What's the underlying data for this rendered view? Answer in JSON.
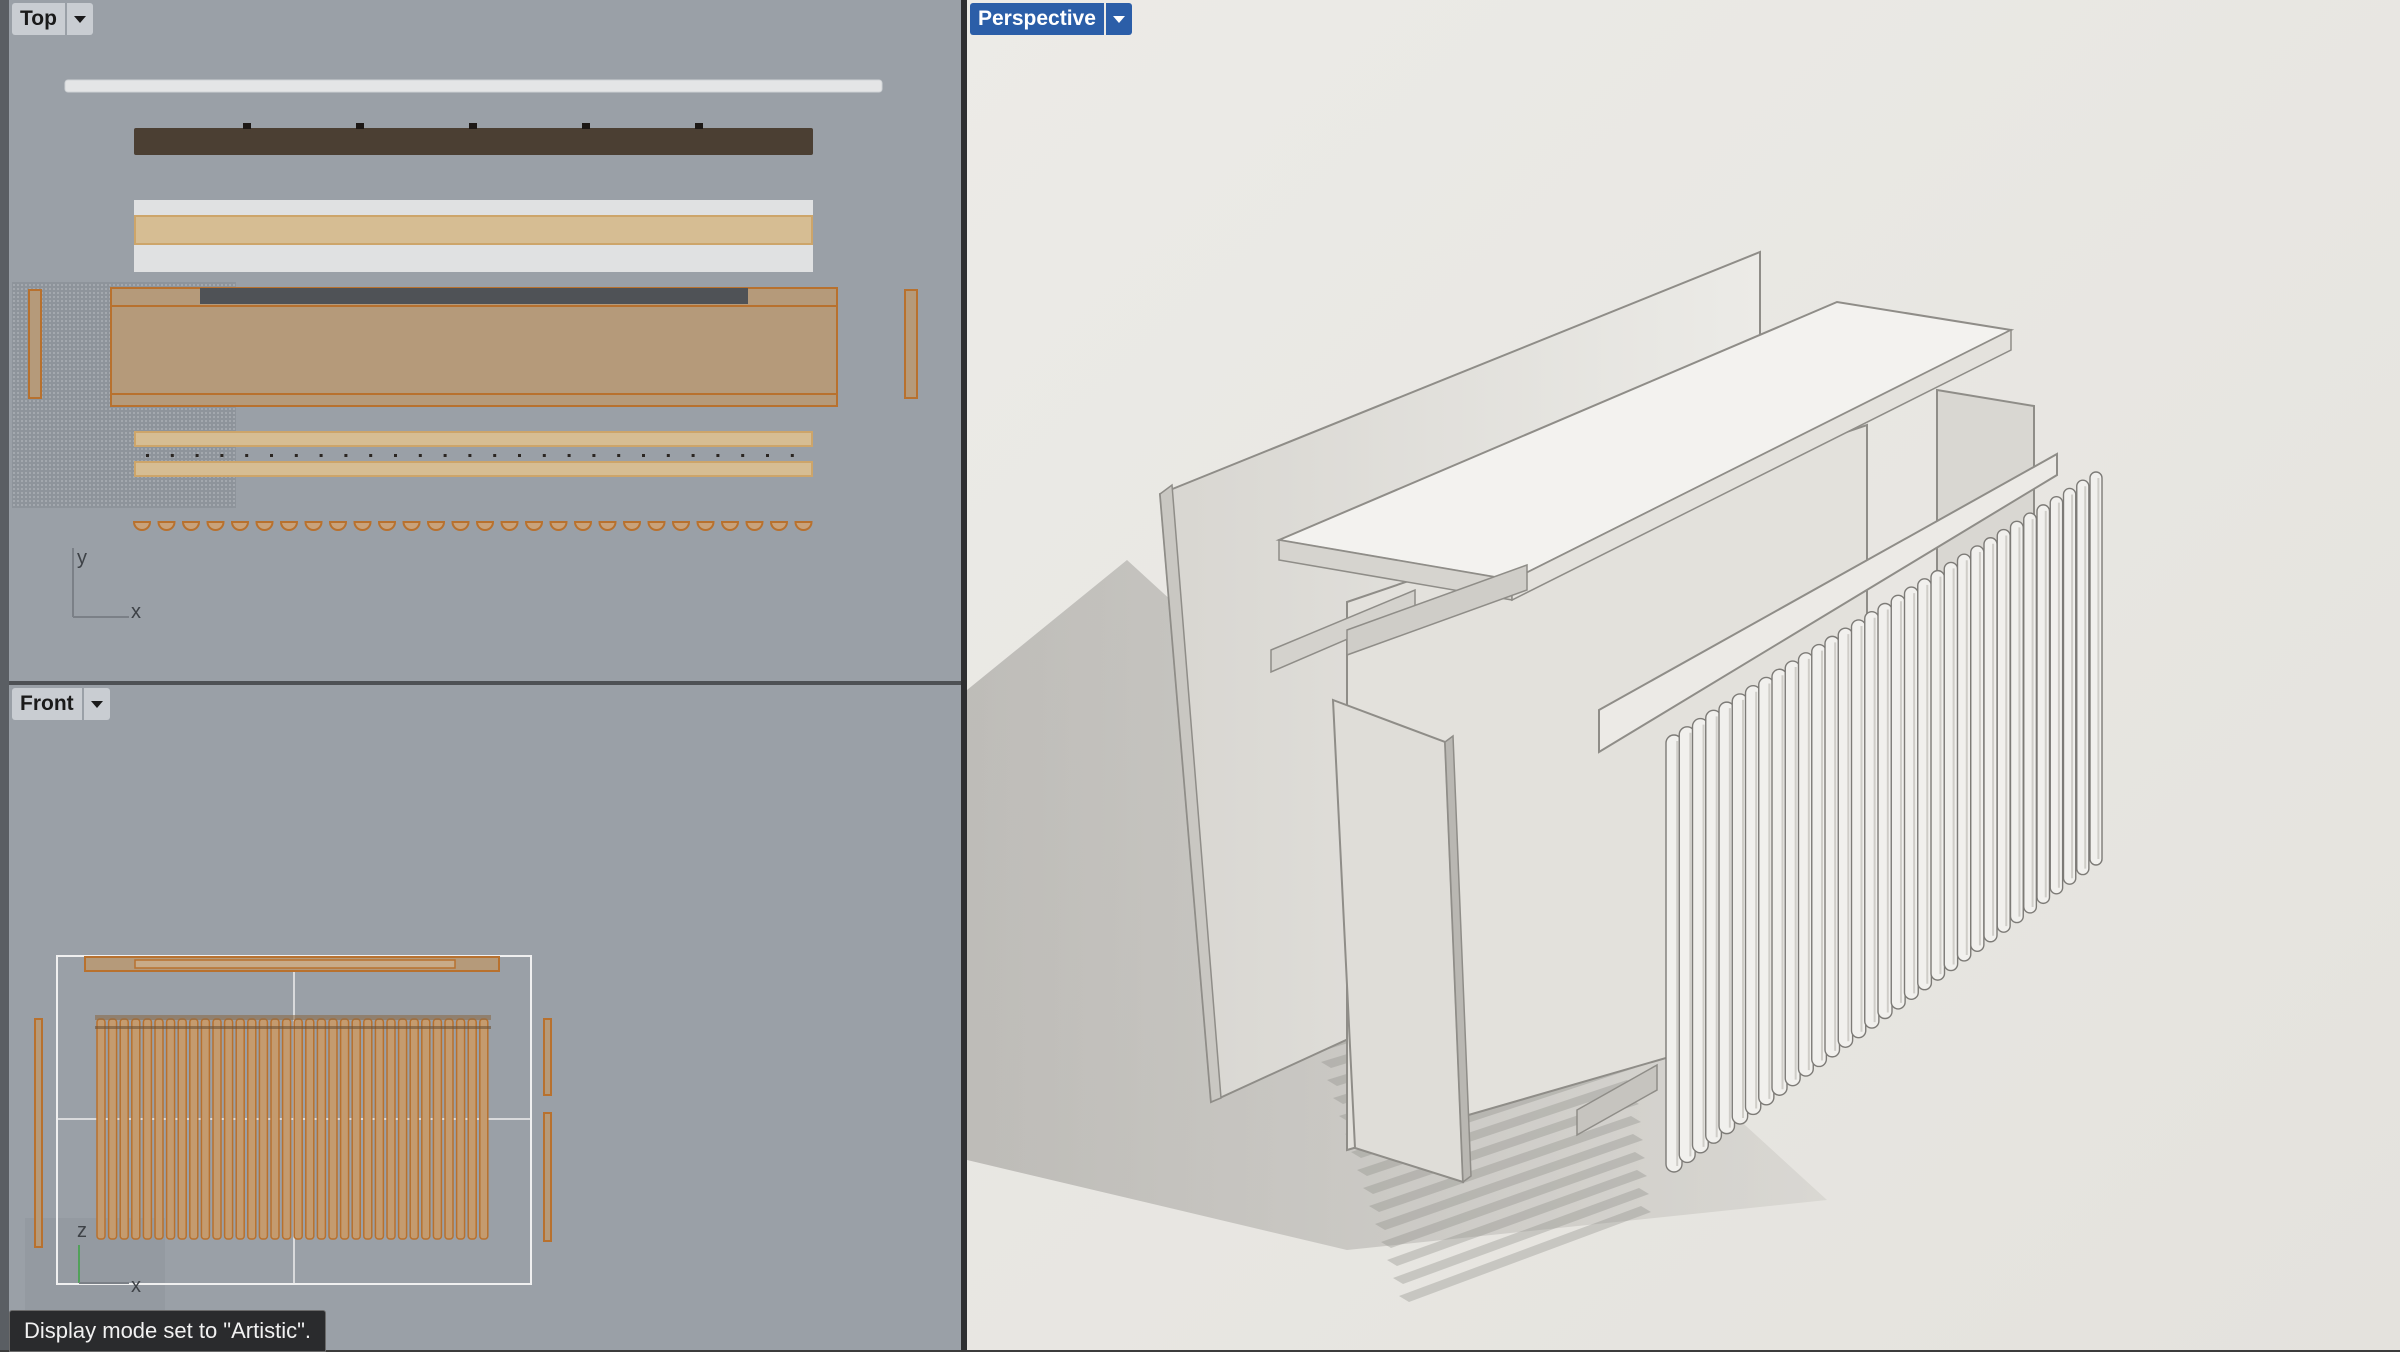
{
  "viewports": {
    "top": {
      "label": "Top"
    },
    "front": {
      "label": "Front"
    },
    "perspective": {
      "label": "Perspective"
    }
  },
  "axes": {
    "top": {
      "y": "y",
      "x": "x"
    },
    "front": {
      "z": "z",
      "x": "x"
    }
  },
  "status_message": "Display mode set to \"Artistic\".",
  "colors": {
    "viewport_bg": "#9aa0a7",
    "active_label": "#2b5ea8",
    "wood": "#b59a7a",
    "wood_edge": "#b8712e",
    "dark_wood": "#4b3f33",
    "perspective_bg": "#ebe9e5"
  },
  "icons": [
    "dropdown-arrow-icon"
  ]
}
